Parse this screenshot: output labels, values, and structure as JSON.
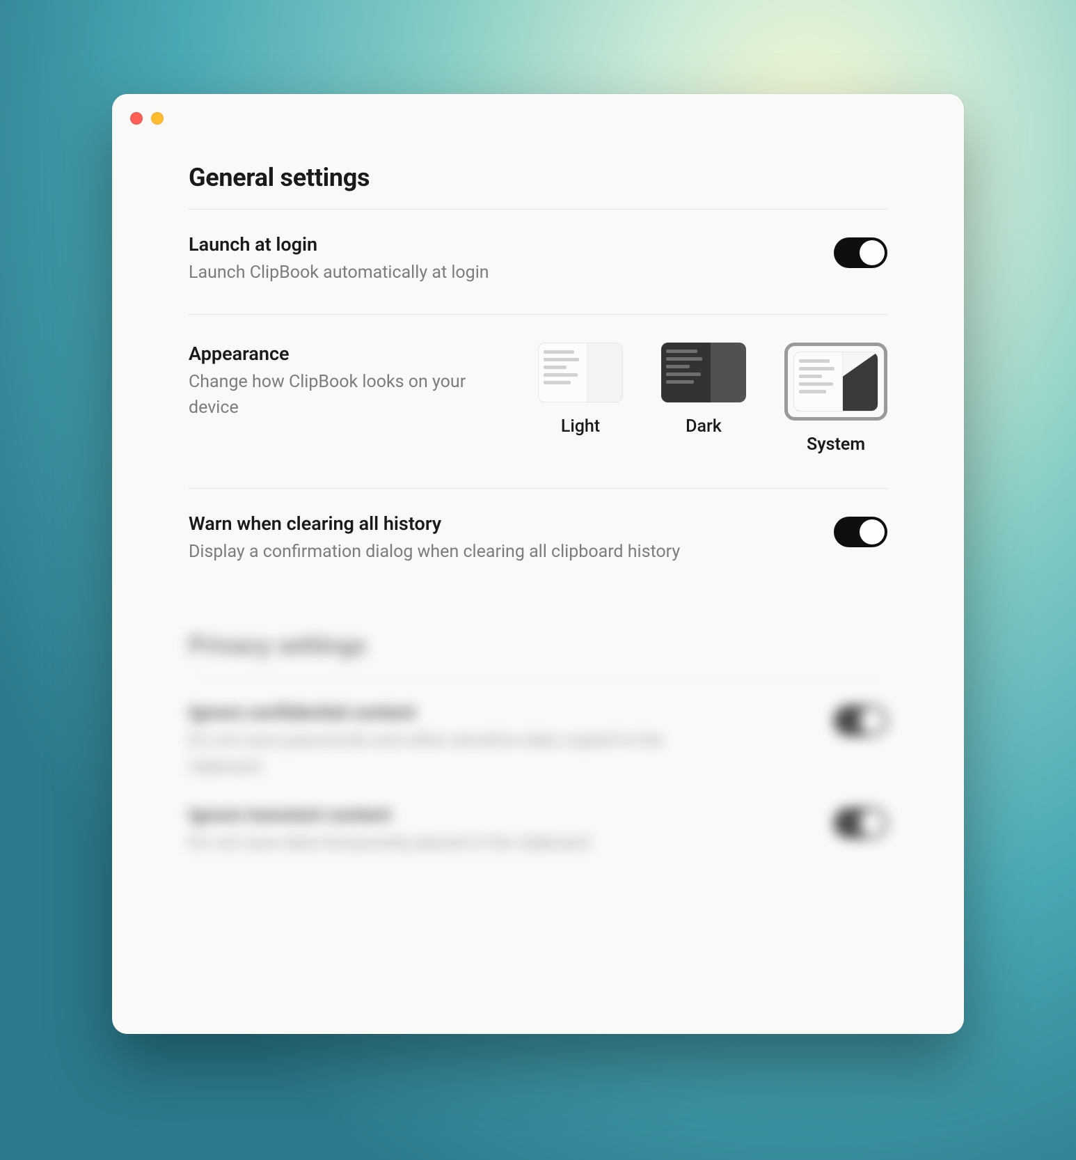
{
  "window": {
    "traffic_lights": [
      "close",
      "minimize"
    ]
  },
  "general": {
    "title": "General settings",
    "launch": {
      "title": "Launch at login",
      "desc": "Launch ClipBook automatically at login",
      "enabled": true
    },
    "appearance": {
      "title": "Appearance",
      "desc": "Change how ClipBook looks on your device",
      "options": {
        "light": "Light",
        "dark": "Dark",
        "system": "System"
      },
      "selected": "system"
    },
    "warn_clear": {
      "title": "Warn when clearing all history",
      "desc": "Display a confirmation dialog when clearing all clipboard history",
      "enabled": true
    }
  },
  "privacy": {
    "title": "Privacy settings",
    "confidential": {
      "title": "Ignore confidential content",
      "desc": "Do not save passwords and other sensitive data copied to the clipboard",
      "enabled": true
    },
    "transient": {
      "title": "Ignore transient content",
      "desc": "Do not save data temporarily placed in the clipboard",
      "enabled": true
    }
  }
}
